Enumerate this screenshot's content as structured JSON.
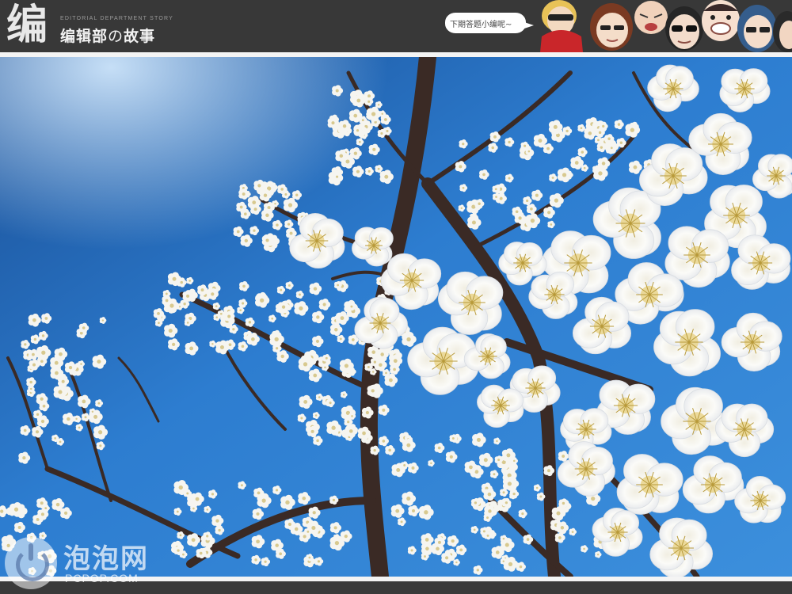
{
  "header": {
    "logo_glyph": "编",
    "logo_subtitle_en": "EDITORIAL DEPARTMENT STORY",
    "logo_title_part1": "编辑部",
    "logo_title_no": "の",
    "logo_title_part2": "故事",
    "speech_bubble": "下期答题小编呢~"
  },
  "photo": {
    "subject": "white plum blossoms against blue sky",
    "colors": {
      "sky_top": "#1f5fa8",
      "sky_mid": "#2c7fd4",
      "sky_light": "#8fc2ec",
      "petal": "#f7f7f4",
      "branch": "#3b2a24"
    }
  },
  "watermark": {
    "brand_cn": "泡泡网",
    "url": "PCPOP.COM"
  }
}
